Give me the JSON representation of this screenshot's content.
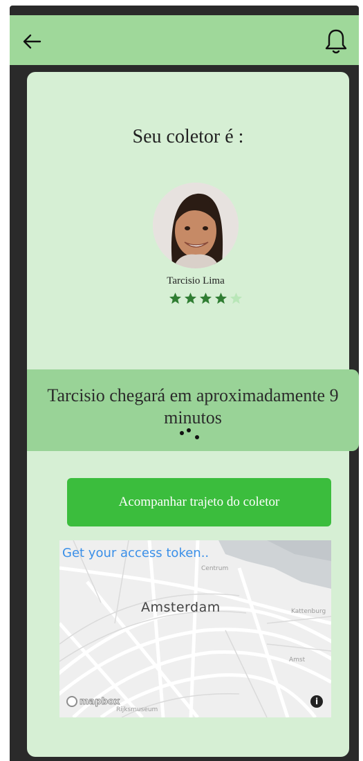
{
  "header": {
    "back_icon": "arrow-left-icon",
    "notification_icon": "bell-icon"
  },
  "collector": {
    "heading": "Seu coletor é :",
    "name": "Tarcisio Lima",
    "avatar_icon": "user-avatar",
    "rating": 4,
    "max_rating": 5,
    "star_color_filled": "#2f7d32",
    "star_color_empty": "#b9e6b8"
  },
  "eta": {
    "message": "Tarcisio chegará em aproximadamente 9 minutos",
    "loading_icon": "loading-dots-icon"
  },
  "track_button": {
    "label": "Acompanhar trajeto do coletor",
    "color": "#3bbd3d"
  },
  "map": {
    "token_link": "Get your access token..",
    "city": "Amsterdam",
    "label_centrum": "Centrum",
    "label_oost": "Kattenburg",
    "label_amst": "Amst",
    "label_museum": "Rijksmuseum",
    "logo_text": "mapbox",
    "info_label": "i"
  },
  "colors": {
    "topbar": "#9fd89a",
    "card": "#d6efd4",
    "eta_band": "#99d397"
  }
}
